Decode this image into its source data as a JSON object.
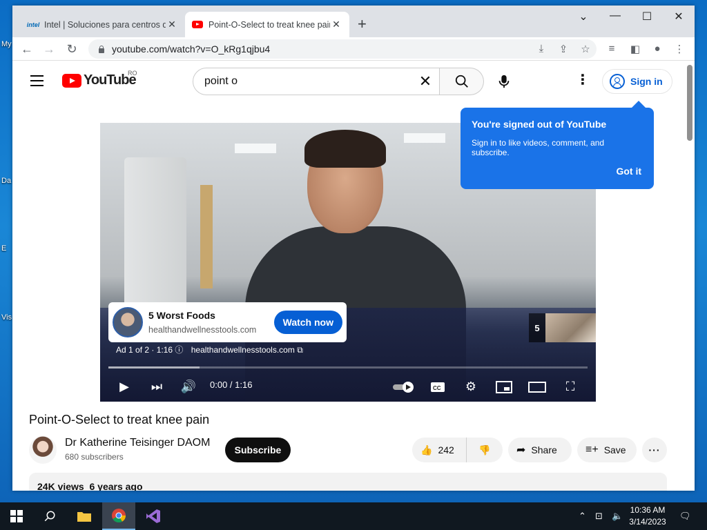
{
  "desktop": {
    "icons": [
      "My",
      "Da",
      "E",
      "Vis"
    ]
  },
  "browser": {
    "tabs": [
      {
        "title": "Intel | Soluciones para centros de",
        "favicon": "intel",
        "close": "✕",
        "active": false
      },
      {
        "title": "Point-O-Select to treat knee pain",
        "favicon": "youtube",
        "close": "✕",
        "active": true
      }
    ],
    "new_tab": "+",
    "url": "youtube.com/watch?v=O_kRg1qjbu4"
  },
  "youtube": {
    "logo_text": "YouTube",
    "region": "RO",
    "search_query": "point o",
    "signin_label": "Sign in",
    "tooltip": {
      "title": "You're signed out of YouTube",
      "body": "Sign in to like videos, comment, and subscribe.",
      "button": "Got it"
    },
    "ad": {
      "title": "5 Worst Foods",
      "domain": "healthandwellnesstools.com",
      "cta": "Watch now",
      "info": "Ad 1 of 2 · 1:16",
      "info_domain": "healthandwellnesstools.com",
      "skip_count": "5"
    },
    "player": {
      "time": "0:00 / 1:16",
      "buffered_fraction": 0.19
    },
    "video": {
      "title": "Point-O-Select to treat knee pain",
      "channel": "Dr Katherine Teisinger DAOM",
      "subscribers": "680 subscribers",
      "subscribe_label": "Subscribe",
      "likes": "242",
      "share_label": "Share",
      "save_label": "Save",
      "more": "···",
      "meta": "24K views  6 years ago"
    }
  },
  "taskbar": {
    "time": "10:36 AM",
    "date": "3/14/2023"
  },
  "colors": {
    "accent_blue": "#1a73e8",
    "yt_red": "#ff0000",
    "link_blue": "#065fd4"
  }
}
